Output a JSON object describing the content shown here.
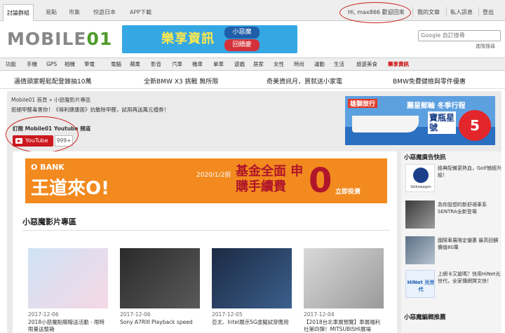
{
  "topbar": {
    "tabs": [
      "討論群組",
      "易點",
      "市集",
      "悅遊日本",
      "APP下載"
    ],
    "welcome": "Hi, max866 歡迎回來",
    "links": [
      "我的文章",
      "私人訊息",
      "登出"
    ]
  },
  "logo": {
    "text": "MOBILE",
    "mark": "01"
  },
  "top_banner": {
    "title": "樂享資訊",
    "badge1": "小惡魔",
    "badge2": "回饋慶"
  },
  "search": {
    "placeholder": "Google 自訂搜尋",
    "advanced": "進階搜尋"
  },
  "categories": [
    "功能",
    "手機",
    "GPS",
    "相機",
    "筆電",
    "電腦",
    "蘋果",
    "影音",
    "汽車",
    "機車",
    "單車",
    "遊戲",
    "居家",
    "女性",
    "時尚",
    "運動",
    "生活",
    "旅遊美食",
    "樂享資訊"
  ],
  "promos": [
    "邁倩頭家輕鬆配登錄抽10萬",
    "全新BMW X3 挑戰 無所限",
    "奇美資訊月，買就送小家電",
    "BMW免費健檢與零件優惠"
  ],
  "breadcrumb": "Mobile01 首頁 » 小惡魔影片專區",
  "notice": "拒絕甲醛毒害你！《得利健康居》抗敏除甲醛，試用再送萬元禮券！",
  "subscribe": {
    "title": "訂閱 Mobile01 Youtube 頻道",
    "button": "YouTube",
    "count": "999+"
  },
  "cruise_ad": {
    "brand": "雄獅旅行",
    "headline": "麗星郵輪 冬季行程",
    "ship": "寶瓶星號",
    "badge": "5"
  },
  "bank_ad": {
    "brand": "O BANK",
    "slogan": "王道來O!",
    "date": "2020/1/2前",
    "headline": "基金全面 申購手續費",
    "zero": "0",
    "cta": "立即投資"
  },
  "section_title": "小惡魔影片專區",
  "videos": [
    {
      "date": "2017-12-06",
      "title": "2018小惡魔點贈贈送活動 - 限時限量送整箱"
    },
    {
      "date": "2017-12-06",
      "title": "Sony A7RIII Playback speed"
    },
    {
      "date": "2017-12-05",
      "title": "亞太、Intel展示5G虛擬試穿應用"
    },
    {
      "date": "2017-12-04",
      "title": "【2018台北車展預覽】車展福利社第四彈！MITSUBISHI展場"
    }
  ],
  "sidebar": {
    "title": "小惡魔廣告快訊",
    "items": [
      {
        "text": "經典配備更熱血，Golf憾經升級！",
        "brand": "Volkswagen"
      },
      {
        "text": "為你設想的新舒適車系SENTRA全新登場"
      },
      {
        "text": "國際車展限定優惠 最高回饋價值80萬"
      },
      {
        "text": "上網卡又搶嗎？快用HiNet光世代，全家傳網擇文快！",
        "brand": "HiNet 光世代"
      }
    ],
    "title2": "小惡魔編輯推薦"
  },
  "colors": {
    "accent_green": "#4f9b2a",
    "annotation_red": "#c8201c",
    "youtube_red": "#cc181e"
  }
}
